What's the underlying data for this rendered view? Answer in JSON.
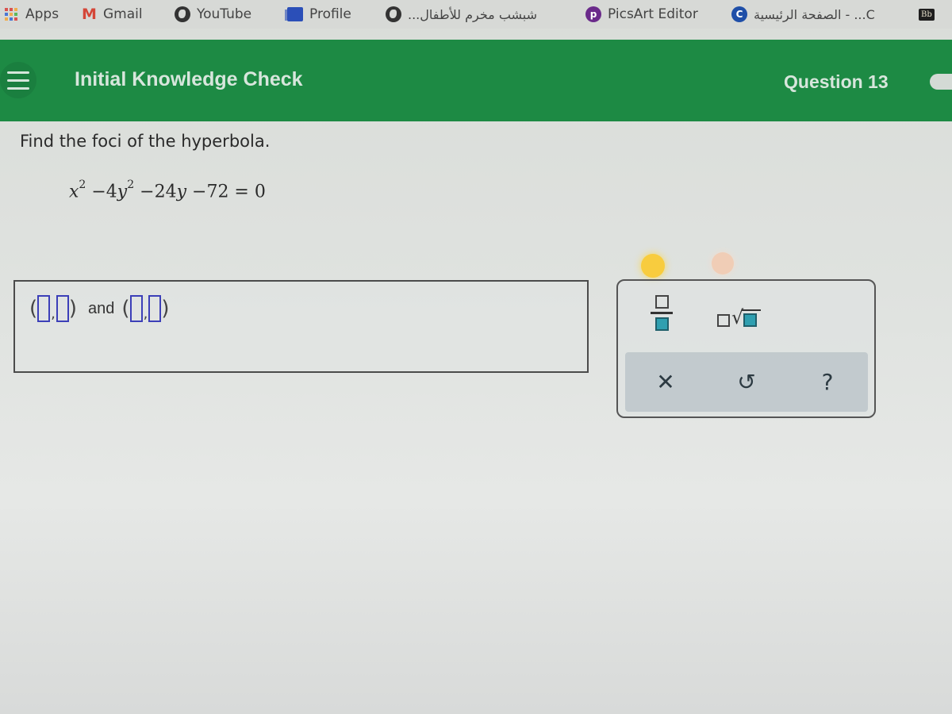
{
  "bookmarks": [
    {
      "label": "Apps",
      "icon": "apps-grid-icon"
    },
    {
      "label": "Gmail",
      "icon": "gmail-icon"
    },
    {
      "label": "YouTube",
      "icon": "globe-icon"
    },
    {
      "label": "Profile",
      "icon": "profile-icon"
    },
    {
      "label": "شبشب مخرم للأطفال...",
      "icon": "globe-icon"
    },
    {
      "label": "PicsArt Editor",
      "icon": "picsart-icon",
      "icon_glyph": "p",
      "icon_color": "#6a2a8a"
    },
    {
      "label": "الصفحة الرئيسية - ...C",
      "icon": "c-icon",
      "icon_glyph": "C",
      "icon_color": "#1f4fa8"
    },
    {
      "label": "Bb",
      "icon": "blackboard-icon"
    }
  ],
  "header": {
    "title": "Initial Knowledge Check",
    "question": "Question 13",
    "color": "#1d8a44"
  },
  "question": {
    "prompt": "Find the foci of the hyperbola.",
    "equation": {
      "t1_var": "x",
      "t1_exp": "2",
      "t2": "−4",
      "t2_var": "y",
      "t2_exp": "2",
      "t3": "−24",
      "t3_var": "y",
      "t4": "−72 = 0"
    }
  },
  "answer": {
    "open_paren": "(",
    "comma": ",",
    "close_paren": ")",
    "joiner": "and",
    "slot_color": "#3c3fb8",
    "values": [
      "",
      "",
      "",
      ""
    ]
  },
  "toolbox": {
    "tools": [
      "fraction",
      "nth-root"
    ],
    "radical_glyph": "√",
    "actions": [
      {
        "name": "clear",
        "glyph": "✕"
      },
      {
        "name": "undo",
        "glyph": "↺"
      },
      {
        "name": "help",
        "glyph": "?"
      }
    ]
  }
}
